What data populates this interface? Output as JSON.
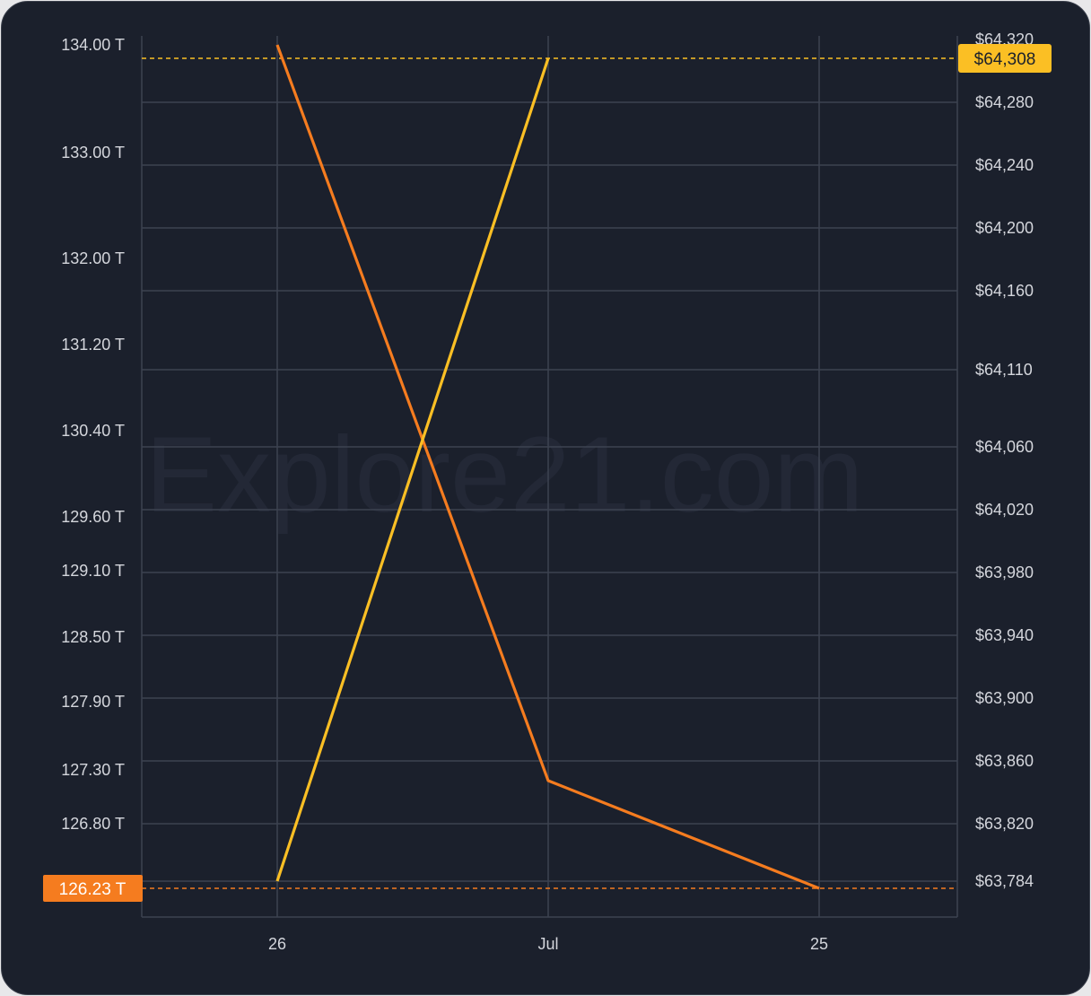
{
  "watermark": "Explore21.com",
  "chart_data": {
    "type": "line",
    "x_ticks": [
      "26",
      "Jul",
      "25"
    ],
    "left_axis": {
      "ticks": [
        "134.00 T",
        "133.00 T",
        "132.00 T",
        "131.20 T",
        "130.40 T",
        "129.60 T",
        "129.10 T",
        "128.50 T",
        "127.90 T",
        "127.30 T",
        "126.80 T"
      ],
      "current_label": "126.23 T",
      "min": 126.23,
      "max": 134.0
    },
    "right_axis": {
      "ticks": [
        "$64,320",
        "$64,280",
        "$64,240",
        "$64,200",
        "$64,160",
        "$64,110",
        "$64,060",
        "$64,020",
        "$63,980",
        "$63,940",
        "$63,900",
        "$63,860",
        "$63,820",
        "$63,784"
      ],
      "current_label": "$64,308",
      "min": 63784,
      "max": 64308
    },
    "series": [
      {
        "axis": "left",
        "color": "#f57c1f",
        "points": [
          {
            "x": "26",
            "y": 134.0
          },
          {
            "x": "Jul",
            "y": 127.2
          },
          {
            "x": "25",
            "y": 126.23
          }
        ]
      },
      {
        "axis": "right",
        "color": "#fbbf24",
        "points": [
          {
            "x": "26",
            "y": 63784
          },
          {
            "x": "Jul",
            "y": 64308
          }
        ]
      }
    ],
    "colors": {
      "left_current": "#f57c1f",
      "right_current": "#fbbf24"
    }
  }
}
